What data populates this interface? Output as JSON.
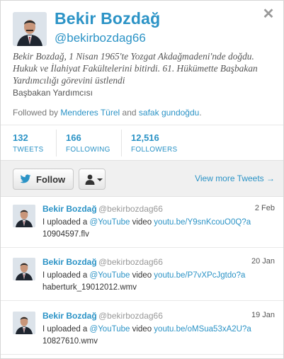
{
  "profile": {
    "name": "Bekir Bozdağ",
    "handle": "@bekirbozdag66",
    "bio": "Bekir Bozdağ, 1 Nisan 1965'te Yozgat Akdağmadeni'nde doğdu. Hukuk ve İlahiyat Fakültelerini bitirdi. 61. Hükümette Başbakan Yardımcılığı görevini üstlendi",
    "subtitle": "Başbakan Yardımcısı",
    "followed_by_prefix": "Followed by",
    "followed_by_user1": "Menderes Türel",
    "followed_by_and": "and",
    "followed_by_user2": "safak gundoğdu",
    "followed_by_suffix": "."
  },
  "stats": [
    {
      "value": "132",
      "label": "TWEETS"
    },
    {
      "value": "166",
      "label": "FOLLOWING"
    },
    {
      "value": "12,516",
      "label": "FOLLOWERS"
    }
  ],
  "actions": {
    "follow_label": "Follow",
    "view_more_label": "View more Tweets →",
    "close_glyph": "✕"
  },
  "tweets": [
    {
      "name": "Bekir Bozdağ",
      "handle": "@bekirbozdag66",
      "date": "2 Feb",
      "text_prefix": "I uploaded a",
      "mention": "@YouTube",
      "text_middle": "video",
      "link": "youtu.be/Y9snKcouO0Q?a",
      "tail": "10904597.flv"
    },
    {
      "name": "Bekir Bozdağ",
      "handle": "@bekirbozdag66",
      "date": "20 Jan",
      "text_prefix": "I uploaded a",
      "mention": "@YouTube",
      "text_middle": "video",
      "link": "youtu.be/P7vXPcJgtdo?a",
      "tail": "haberturk_19012012.wmv"
    },
    {
      "name": "Bekir Bozdağ",
      "handle": "@bekirbozdag66",
      "date": "19 Jan",
      "text_prefix": "I uploaded a",
      "mention": "@YouTube",
      "text_middle": "video",
      "link": "youtu.be/oMSua53xA2U?a",
      "tail": "10827610.wmv"
    }
  ],
  "colors": {
    "accent": "#2b93c6",
    "action_bar": "#f0f0f0"
  },
  "icons": [
    "close-icon",
    "twitter-bird-icon",
    "user-icon",
    "caret-down-icon"
  ]
}
